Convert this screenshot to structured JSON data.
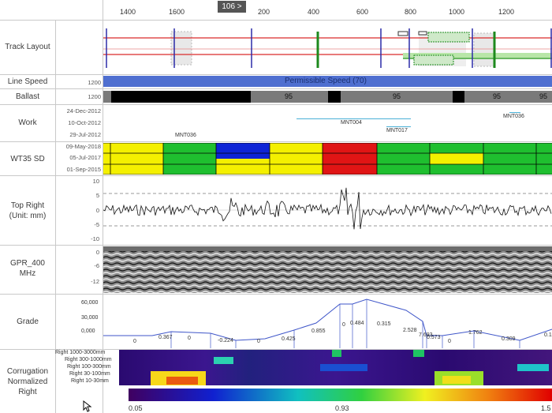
{
  "ruler": {
    "ticks": [
      "1400",
      "1600",
      "200",
      "400",
      "600",
      "800",
      "1000",
      "1200"
    ],
    "marker": "106 >"
  },
  "rows": {
    "track_layout": "Track Layout",
    "line_speed": "Line Speed",
    "ballast": "Ballast",
    "work": "Work",
    "wt35": "WT35 SD",
    "top_right": "Top Right (Unit: mm)",
    "gpr": "GPR_400 MHz",
    "grade": "Grade",
    "corrugation": "Corrugation Normalized Right"
  },
  "line_speed": {
    "sub": "1200",
    "text": "Permissible Speed (70)",
    "color": "#4f6fd0"
  },
  "ballast": {
    "sub": "1200",
    "values": [
      "95",
      "95",
      "95",
      "95"
    ]
  },
  "work": {
    "dates": [
      "24-Dec-2012",
      "10-Oct-2012",
      "29-Jul-2012"
    ],
    "items": [
      "MNT004",
      "MNT017",
      "MNT036",
      "MNT036"
    ]
  },
  "wt35": {
    "dates": [
      "09-May-2018",
      "05-Jul-2017",
      "01-Sep-2015"
    ]
  },
  "top_right": {
    "ticks": [
      "10",
      "5",
      "0",
      "-5",
      "-10"
    ]
  },
  "gpr": {
    "ticks": [
      "0",
      "-6",
      "-12"
    ]
  },
  "grade": {
    "ticks": [
      "60,000",
      "30,000",
      "0,000"
    ],
    "values": [
      "0",
      "0.367",
      "0",
      "-0.224",
      "0",
      "0.425",
      "0.855",
      "0",
      "0.484",
      "0.315",
      "2.528",
      "7.693",
      "0.573",
      "0",
      "1.762",
      "0.309",
      "0.1"
    ]
  },
  "corrugation": {
    "bands": [
      "Right 1000-3000mm",
      "Right 300-1000mm",
      "Right 100-300mm",
      "Right 30-100mm",
      "Right 10-30mm"
    ],
    "scale": [
      "0.05",
      "0.93",
      "1.5"
    ]
  },
  "colors": {
    "rail": "#d92b2b",
    "signal": "#2a2aa8",
    "green_post": "#1d8a1d"
  }
}
